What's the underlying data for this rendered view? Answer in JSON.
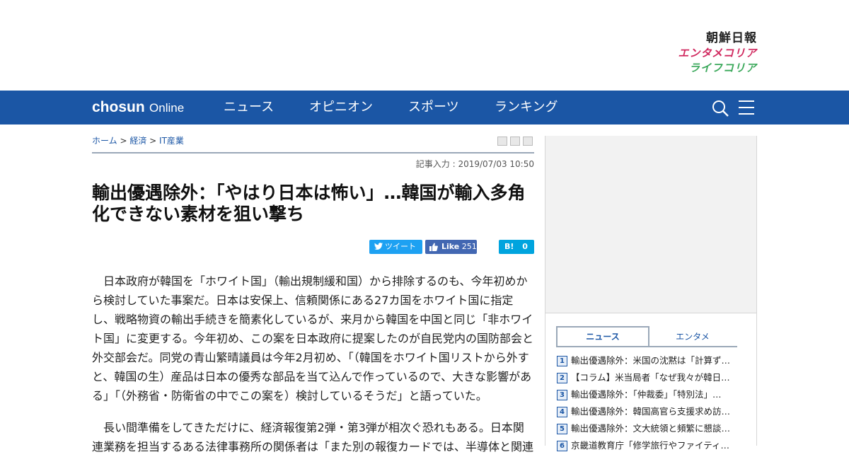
{
  "brand": {
    "line1": "朝鮮日報",
    "line2": "エンタメコリア",
    "line3": "ライフコリア"
  },
  "nav": {
    "logo_bold": "chosun",
    "logo_light": "Online",
    "items": [
      "ニュース",
      "オピニオン",
      "スポーツ",
      "ランキング"
    ]
  },
  "breadcrumb": {
    "home": "ホーム",
    "sep": " > ",
    "section": "経済",
    "subsection": "IT産業"
  },
  "article": {
    "date": "記事入力 : 2019/07/03 10:50",
    "headline": "輸出優遇除外：「やはり日本は怖い」…韓国が輸入多角化できない素材を狙い撃ち",
    "paragraphs": [
      "日本政府が韓国を「ホワイト国」（輸出規制緩和国）から排除するのも、今年初めから検討していた事案だ。日本は安保上、信頼関係にある27カ国をホワイト国に指定し、戦略物資の輸出手続きを簡素化しているが、来月から韓国を中国と同じ「非ホワイト国」に変更する。今年初め、この案を日本政府に提案したのが自民党内の国防部会と外交部会だ。同党の青山繁晴議員は今年2月初め、「（韓国をホワイト国リストから外すと、韓国の生）産品は日本の優秀な部品を当て込んで作っているので、大きな影響がある」「（外務省・防衛省の中でこの案を）検討しているそうだ」と語っていた。",
      "長い間準備をしてきただけに、経済報復第2弾・第3弾が相次ぐ恐れもある。日本関連業務を担当するある法律事務所の関係者は「また別の報復カードでは、半導体と関連"
    ]
  },
  "share": {
    "tweet": "ツイート",
    "like": "Like",
    "like_count": "251",
    "hatena": "B!",
    "hatena_count": "0"
  },
  "sidebar": {
    "tabs": [
      "ニュース",
      "エンタメ"
    ],
    "ranking": [
      {
        "num": "1",
        "title": "輸出優遇除外：米国の沈黙は「計算ずく」…"
      },
      {
        "num": "2",
        "title": "【コラム】米当局者「なぜ我々が韓日の…"
      },
      {
        "num": "3",
        "title": "輸出優遇除外：「仲裁委」「特別法」…"
      },
      {
        "num": "4",
        "title": "輸出優遇除外：韓国高官ら支援求め訪米…"
      },
      {
        "num": "5",
        "title": "輸出優遇除外：文大統領と頻繁に懇談…"
      },
      {
        "num": "6",
        "title": "京畿道教育庁「修学旅行やファイティン…"
      }
    ]
  }
}
